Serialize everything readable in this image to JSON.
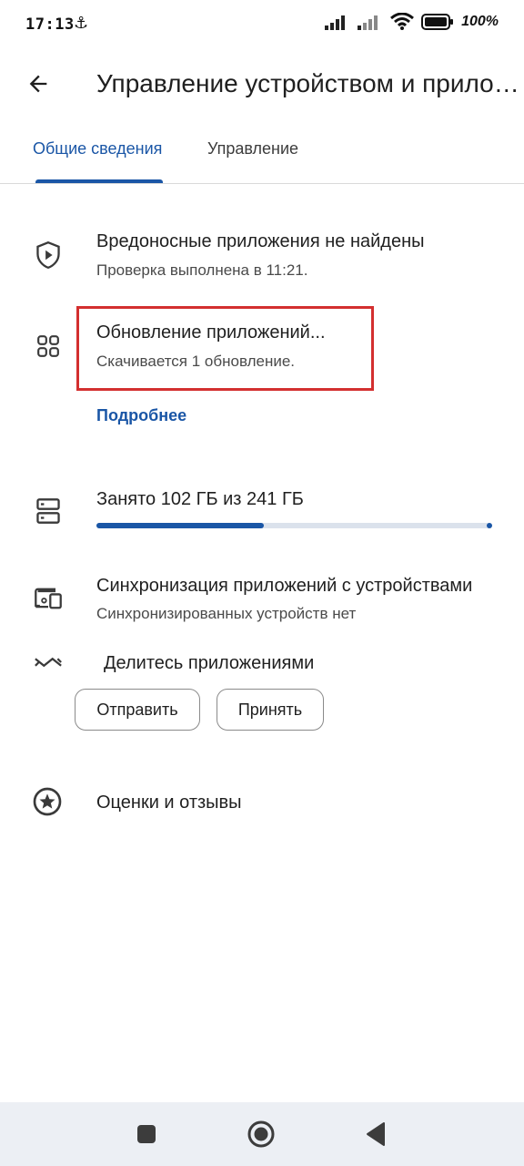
{
  "status_bar": {
    "time": "17:13",
    "battery_percent": "100%"
  },
  "header": {
    "title": "Управление устройством и прило…",
    "back_icon": "arrow-back-icon"
  },
  "tabs": [
    {
      "label": "Общие сведения",
      "selected": true
    },
    {
      "label": "Управление",
      "selected": false
    }
  ],
  "security": {
    "icon": "play-protect-shield-icon",
    "title": "Вредоносные приложения не найдены",
    "subtitle": "Проверка выполнена в 11:21."
  },
  "updates": {
    "icon": "apps-grid-icon",
    "title": "Обновление приложений...",
    "subtitle": "Скачивается 1 обновление.",
    "link": "Подробнее"
  },
  "storage": {
    "icon": "storage-icon",
    "title": "Занято 102 ГБ из 241 ГБ",
    "used_fraction": 0.423
  },
  "sync": {
    "icon": "devices-icon",
    "title": "Синхронизация приложений с устройствами",
    "subtitle": "Синхронизированных устройств нет"
  },
  "share": {
    "icon": "share-apps-icon",
    "title": "Делитесь приложениями",
    "send_label": "Отправить",
    "receive_label": "Принять"
  },
  "ratings": {
    "icon": "star-circle-icon",
    "title": "Оценки и отзывы"
  },
  "colors": {
    "accent": "#1a56a6",
    "highlight": "#d32f2f",
    "navbar_bg": "#eceff4"
  }
}
